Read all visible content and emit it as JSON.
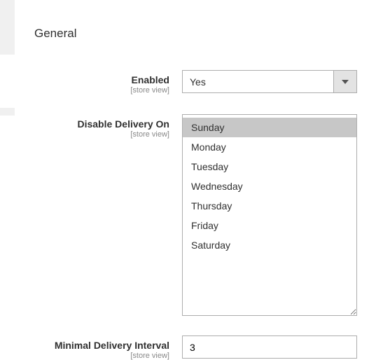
{
  "sectionTitle": "General",
  "fields": {
    "enabled": {
      "label": "Enabled",
      "scope": "[store view]",
      "value": "Yes"
    },
    "disableDelivery": {
      "label": "Disable Delivery On",
      "scope": "[store view]",
      "options": [
        {
          "label": "Sunday",
          "selected": true
        },
        {
          "label": "Monday",
          "selected": false
        },
        {
          "label": "Tuesday",
          "selected": false
        },
        {
          "label": "Wednesday",
          "selected": false
        },
        {
          "label": "Thursday",
          "selected": false
        },
        {
          "label": "Friday",
          "selected": false
        },
        {
          "label": "Saturday",
          "selected": false
        }
      ]
    },
    "minInterval": {
      "label": "Minimal Delivery Interval",
      "scope": "[store view]",
      "value": "3"
    }
  }
}
